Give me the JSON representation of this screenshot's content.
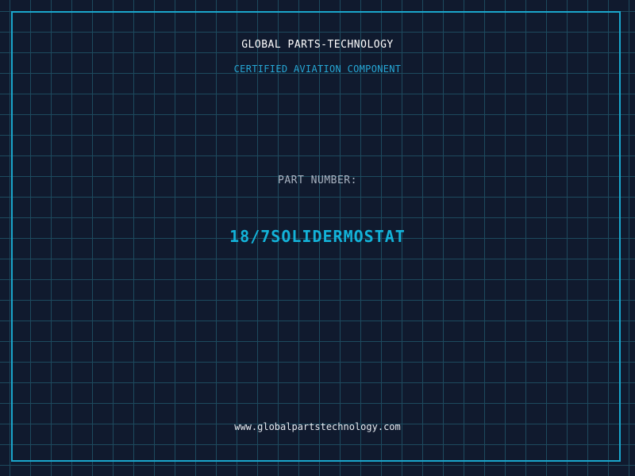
{
  "header": {
    "company": "GLOBAL PARTS-TECHNOLOGY",
    "subtitle": "CERTIFIED AVIATION COMPONENT"
  },
  "part": {
    "label": "PART NUMBER:",
    "number": "18/7SOLIDERMOSTAT"
  },
  "footer": {
    "url": "www.globalpartstechnology.com"
  },
  "colors": {
    "background": "#101a2e",
    "grid": "#1d4a5e",
    "accent": "#13b3d9",
    "frame": "#1aa6cc"
  }
}
